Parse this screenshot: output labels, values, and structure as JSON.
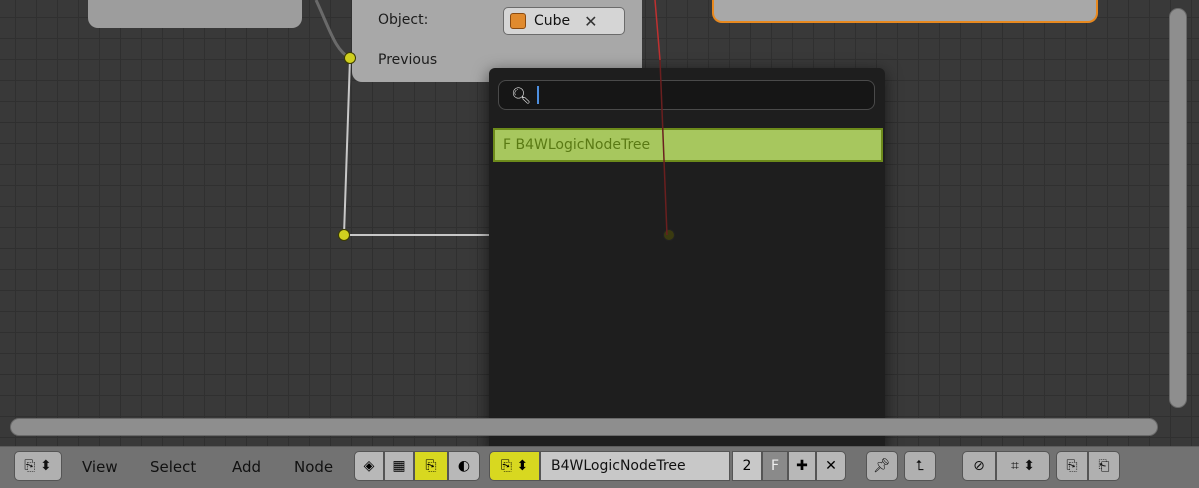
{
  "node_editor": {
    "object_label": "Object:",
    "object_value": "Cube",
    "previous_label": "Previous"
  },
  "search_popup": {
    "search_value": "",
    "result_item": "F B4WLogicNodeTree"
  },
  "header": {
    "menu": [
      "View",
      "Select",
      "Add",
      "Node"
    ],
    "tree_name": "B4WLogicNodeTree",
    "users_count": "2",
    "fake_user": "F"
  },
  "colors": {
    "accent_yellow": "#e0e020",
    "socket_yellow": "#cfcf1f",
    "result_green": "#a7c75e",
    "node_orange": "#e8891f"
  },
  "icons": [
    "editor-type-icon",
    "search-icon",
    "cube-icon",
    "close-icon",
    "add-icon",
    "pin-icon",
    "parent-icon",
    "snap-icon",
    "copy-icon",
    "paste-icon"
  ]
}
